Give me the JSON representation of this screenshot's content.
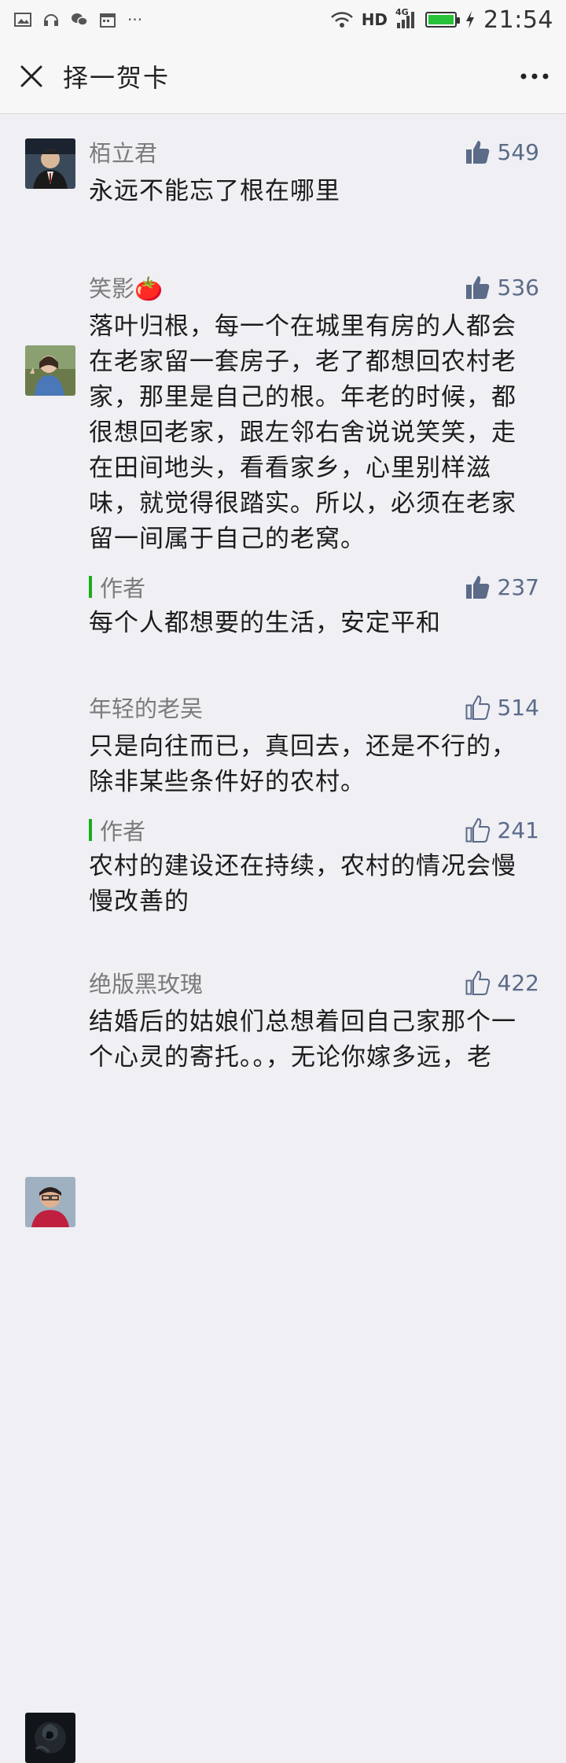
{
  "status_bar": {
    "network": "HD",
    "signal_type": "4G",
    "time": "21:54",
    "battery_color": "#27c23a"
  },
  "header": {
    "title": "择一贺卡",
    "close_icon": "close-icon",
    "more_icon": "more-icon"
  },
  "comments": [
    {
      "nickname": "栢立君",
      "likes": "549",
      "liked": true,
      "text": "永远不能忘了根在哪里",
      "reply": null
    },
    {
      "nickname": "笑影🍅",
      "likes": "536",
      "liked": true,
      "text": "落叶归根，每一个在城里有房的人都会在老家留一套房子，老了都想回农村老家，那里是自己的根。年老的时候，都很想回老家，跟左邻右舍说说笑笑，走在田间地头，看看家乡，心里别样滋味，就觉得很踏实。所以，必须在老家留一间属于自己的老窝。",
      "reply": {
        "label": "作者",
        "likes": "237",
        "liked": true,
        "text": "每个人都想要的生活，安定平和"
      }
    },
    {
      "nickname": "年轻的老吴",
      "likes": "514",
      "liked": false,
      "text": "只是向往而已，真回去，还是不行的，除非某些条件好的农村。",
      "reply": {
        "label": "作者",
        "likes": "241",
        "liked": false,
        "text": "农村的建设还在持续，农村的情况会慢慢改善的"
      }
    },
    {
      "nickname": "绝版黑玫瑰",
      "likes": "422",
      "liked": false,
      "text": "结婚后的姑娘们总想着回自己家那个一个心灵的寄托。。，无论你嫁多远，老",
      "reply": null
    }
  ],
  "colors": {
    "like_blue": "#5b6b88",
    "author_bar": "#1aad19",
    "background": "#efeff4"
  }
}
